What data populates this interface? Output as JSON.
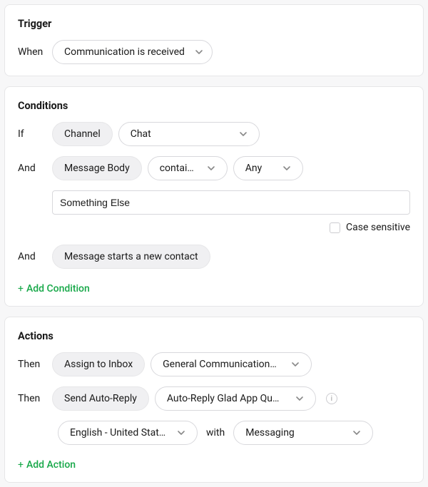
{
  "trigger": {
    "title": "Trigger",
    "when_label": "When",
    "event": "Communication is received"
  },
  "conditions": {
    "title": "Conditions",
    "if_label": "If",
    "and_label": "And",
    "c1": {
      "field": "Channel",
      "value": "Chat"
    },
    "c2": {
      "field": "Message Body",
      "operator": "contains",
      "mode": "Any",
      "value": "Something Else",
      "case_sensitive_label": "Case sensitive"
    },
    "c3": {
      "field": "Message starts a new contact"
    },
    "add_label": "Add Condition"
  },
  "actions": {
    "title": "Actions",
    "then_label": "Then",
    "a1": {
      "action": "Assign to Inbox",
      "target": "General Communication…"
    },
    "a2": {
      "action": "Send Auto-Reply",
      "template": "Auto-Reply Glad App Qu…",
      "language": "English - United States",
      "with_label": "with",
      "channel": "Messaging"
    },
    "add_label": "Add Action"
  }
}
